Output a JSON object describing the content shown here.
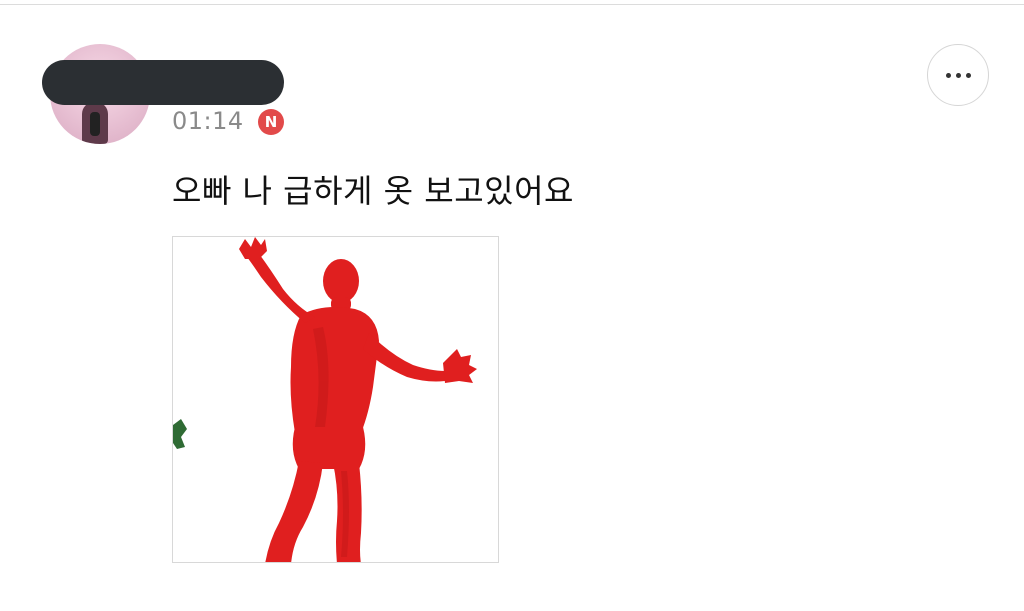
{
  "post": {
    "time": "01:14",
    "new_badge": "N",
    "message": "오빠 나 급하게 옷 보고있어요",
    "more_icon": "more-horizontal-icon",
    "attachment_description_icon": "image-thumbnail"
  },
  "colors": {
    "badge": "#e24a4a",
    "redaction": "#2b2f33",
    "suit": "#e01f1f",
    "time_text": "#8a8a8a"
  }
}
